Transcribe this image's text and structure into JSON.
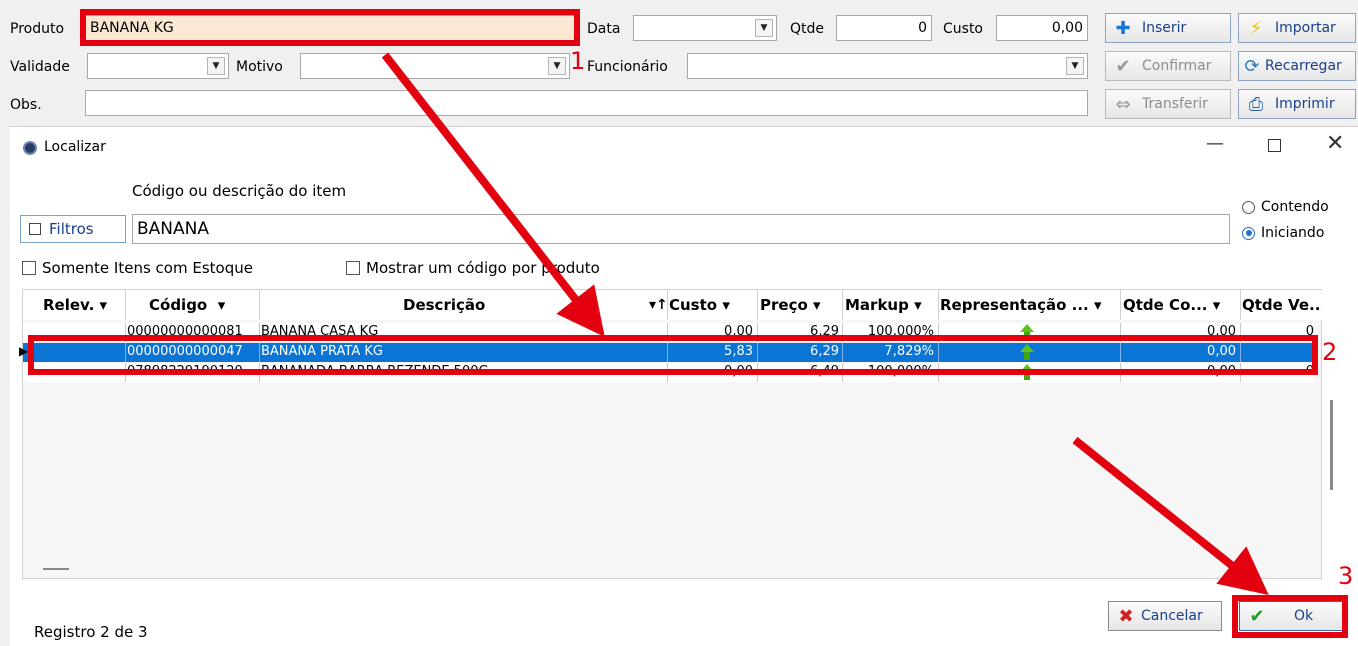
{
  "top_form": {
    "produto_label": "Produto",
    "produto_value": "BANANA KG",
    "data_label": "Data",
    "qtde_label": "Qtde",
    "qtde_value": "0",
    "custo_label": "Custo",
    "custo_value": "0,00",
    "validade_label": "Validade",
    "motivo_label": "Motivo",
    "funcionario_label": "Funcionário",
    "obs_label": "Obs.",
    "buttons": {
      "inserir": "Inserir",
      "importar": "Importar",
      "confirmar": "Confirmar",
      "recarregar": "Recarregar",
      "transferir": "Transferir",
      "imprimir": "Imprimir"
    }
  },
  "dialog": {
    "title": "Localizar",
    "search_label": "Código ou descrição do item",
    "filtros_label": "Filtros",
    "search_value": "BANANA",
    "radio_contendo": "Contendo",
    "radio_iniciando": "Iniciando",
    "check_estoque": "Somente Itens com Estoque",
    "check_codigo": "Mostrar um código por produto",
    "columns": [
      "Relev.",
      "Código",
      "Descrição",
      "Custo",
      "Preço",
      "Markup",
      "Representação ...",
      "Qtde Co...",
      "Qtde Ve..."
    ],
    "rows": [
      {
        "codigo": "00000000000081",
        "descricao": "BANANA CASA KG",
        "custo": "0,00",
        "preco": "6,29",
        "markup": "100,000%",
        "qtde_co": "0,00",
        "qtde_ve": "0"
      },
      {
        "codigo": "00000000000047",
        "descricao": "BANANA PRATA KG",
        "custo": "5,83",
        "preco": "6,29",
        "markup": "7,829%",
        "qtde_co": "0,00",
        "qtde_ve": ""
      },
      {
        "codigo": "07898229190120",
        "descricao": "BANANADA BARRA REZENDE 500G",
        "custo": "0,00",
        "preco": "6,49",
        "markup": "100,000%",
        "qtde_co": "0,00",
        "qtde_ve": "0"
      }
    ],
    "status": "Registro 2 de 3",
    "cancelar_label": "Cancelar",
    "ok_label": "Ok"
  },
  "annotations": {
    "n1": "1",
    "n2": "2",
    "n3": "3",
    "color": "#e3000f"
  }
}
